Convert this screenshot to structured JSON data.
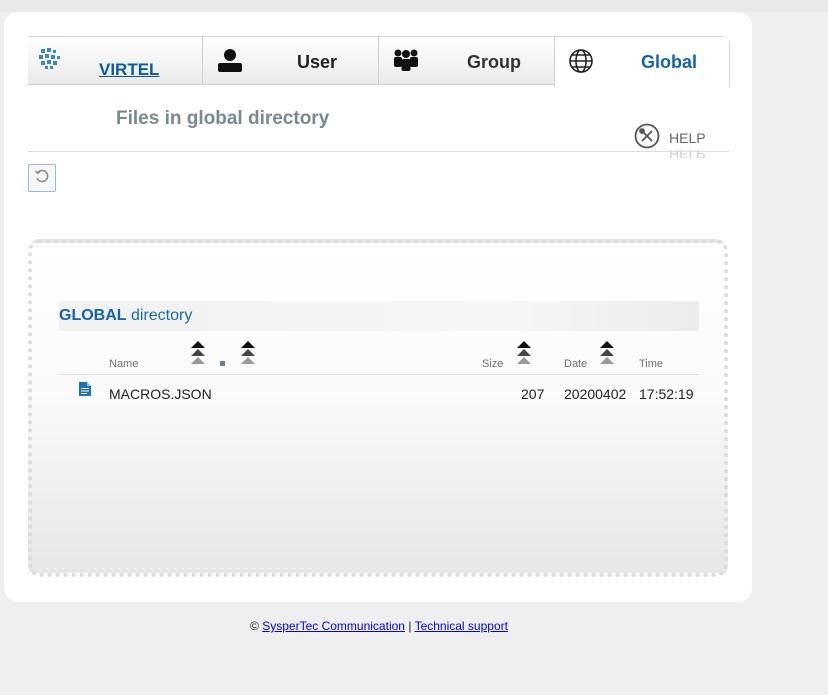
{
  "tabs": [
    {
      "label": "VIRTEL",
      "icon": "virtel-logo-icon"
    },
    {
      "label": "User",
      "icon": "user-icon"
    },
    {
      "label": "Group",
      "icon": "group-icon"
    },
    {
      "label": "Global",
      "icon": "globe-icon",
      "active": true
    }
  ],
  "header": {
    "title": "Files in global directory",
    "help_label": "HELP"
  },
  "toolbar": {
    "refresh_icon": "refresh-icon"
  },
  "directory": {
    "title_bold": "GLOBAL",
    "title_rest": " directory",
    "columns": {
      "name": "Name",
      "size": "Size",
      "date": "Date",
      "time": "Time"
    },
    "rows": [
      {
        "icon": "file-icon",
        "name": "MACROS.JSON",
        "size": "207",
        "date": "20200402",
        "time": "17:52:19"
      }
    ]
  },
  "footer": {
    "copyright": "©",
    "company_link": "SysperTec Communication",
    "separator": "|",
    "support_link": "Technical support"
  },
  "colors": {
    "accent": "#1462ae",
    "title_gray": "#7a8795"
  }
}
